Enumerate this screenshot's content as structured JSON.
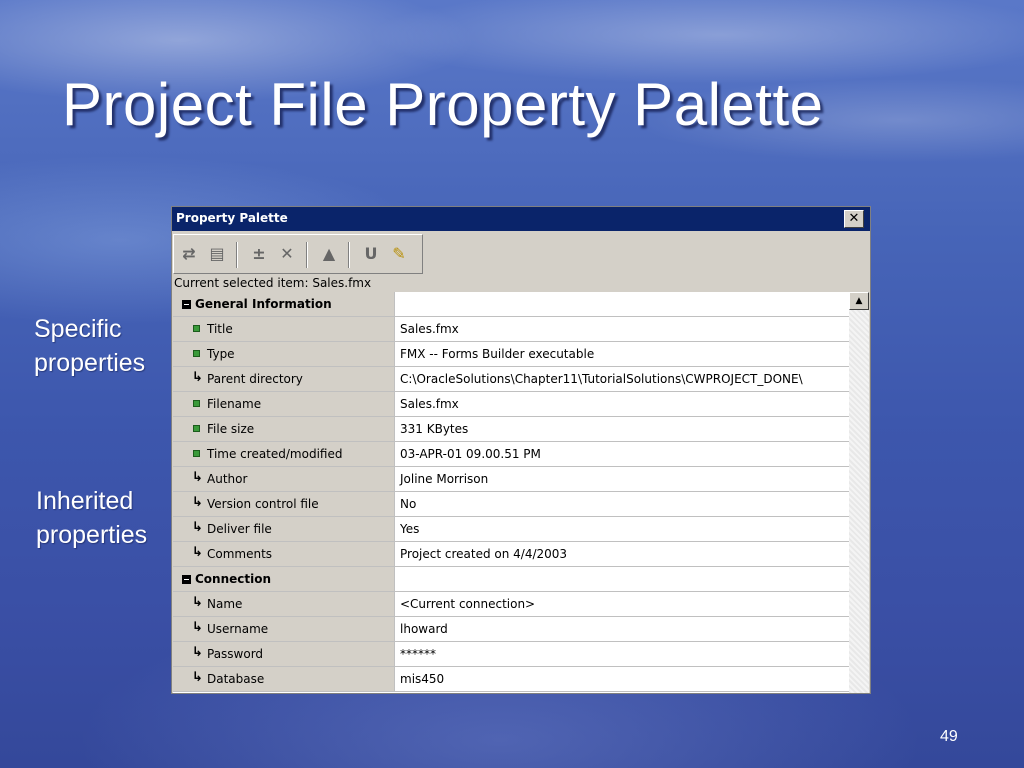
{
  "slide": {
    "title": "Project File Property Palette",
    "page_number": "49"
  },
  "callouts": {
    "specific": [
      "Specific",
      "properties"
    ],
    "inherited": [
      "Inherited",
      "properties"
    ]
  },
  "palette": {
    "title": "Property Palette",
    "close_label": "✕",
    "current_item": "Current selected item: Sales.fmx",
    "toolbar_icons": [
      "copy-properties-icon",
      "paste-properties-icon",
      "add-property-icon",
      "delete-property-icon",
      "inherit-icon",
      "union-icon",
      "pin-icon"
    ],
    "rows": [
      {
        "kind": "group",
        "label": "General Information",
        "value": ""
      },
      {
        "kind": "specific",
        "label": "Title",
        "value": "Sales.fmx"
      },
      {
        "kind": "specific",
        "label": "Type",
        "value": "FMX -- Forms Builder executable"
      },
      {
        "kind": "inherited",
        "label": "Parent directory",
        "value": "C:\\OracleSolutions\\Chapter11\\TutorialSolutions\\CWPROJECT_DONE\\"
      },
      {
        "kind": "specific",
        "label": "Filename",
        "value": "Sales.fmx"
      },
      {
        "kind": "specific",
        "label": "File size",
        "value": "331 KBytes"
      },
      {
        "kind": "specific",
        "label": "Time created/modified",
        "value": "03-APR-01 09.00.51 PM"
      },
      {
        "kind": "inherited",
        "label": "Author",
        "value": "Joline Morrison"
      },
      {
        "kind": "inherited",
        "label": "Version control file",
        "value": "No"
      },
      {
        "kind": "inherited",
        "label": "Deliver file",
        "value": "Yes"
      },
      {
        "kind": "inherited",
        "label": "Comments",
        "value": "Project created on 4/4/2003"
      },
      {
        "kind": "group",
        "label": "Connection",
        "value": ""
      },
      {
        "kind": "inherited",
        "label": "Name",
        "value": "<Current connection>"
      },
      {
        "kind": "inherited",
        "label": "Username",
        "value": "lhoward"
      },
      {
        "kind": "inherited",
        "label": "Password",
        "value": "******"
      },
      {
        "kind": "inherited",
        "label": "Database",
        "value": "mis450"
      }
    ]
  }
}
